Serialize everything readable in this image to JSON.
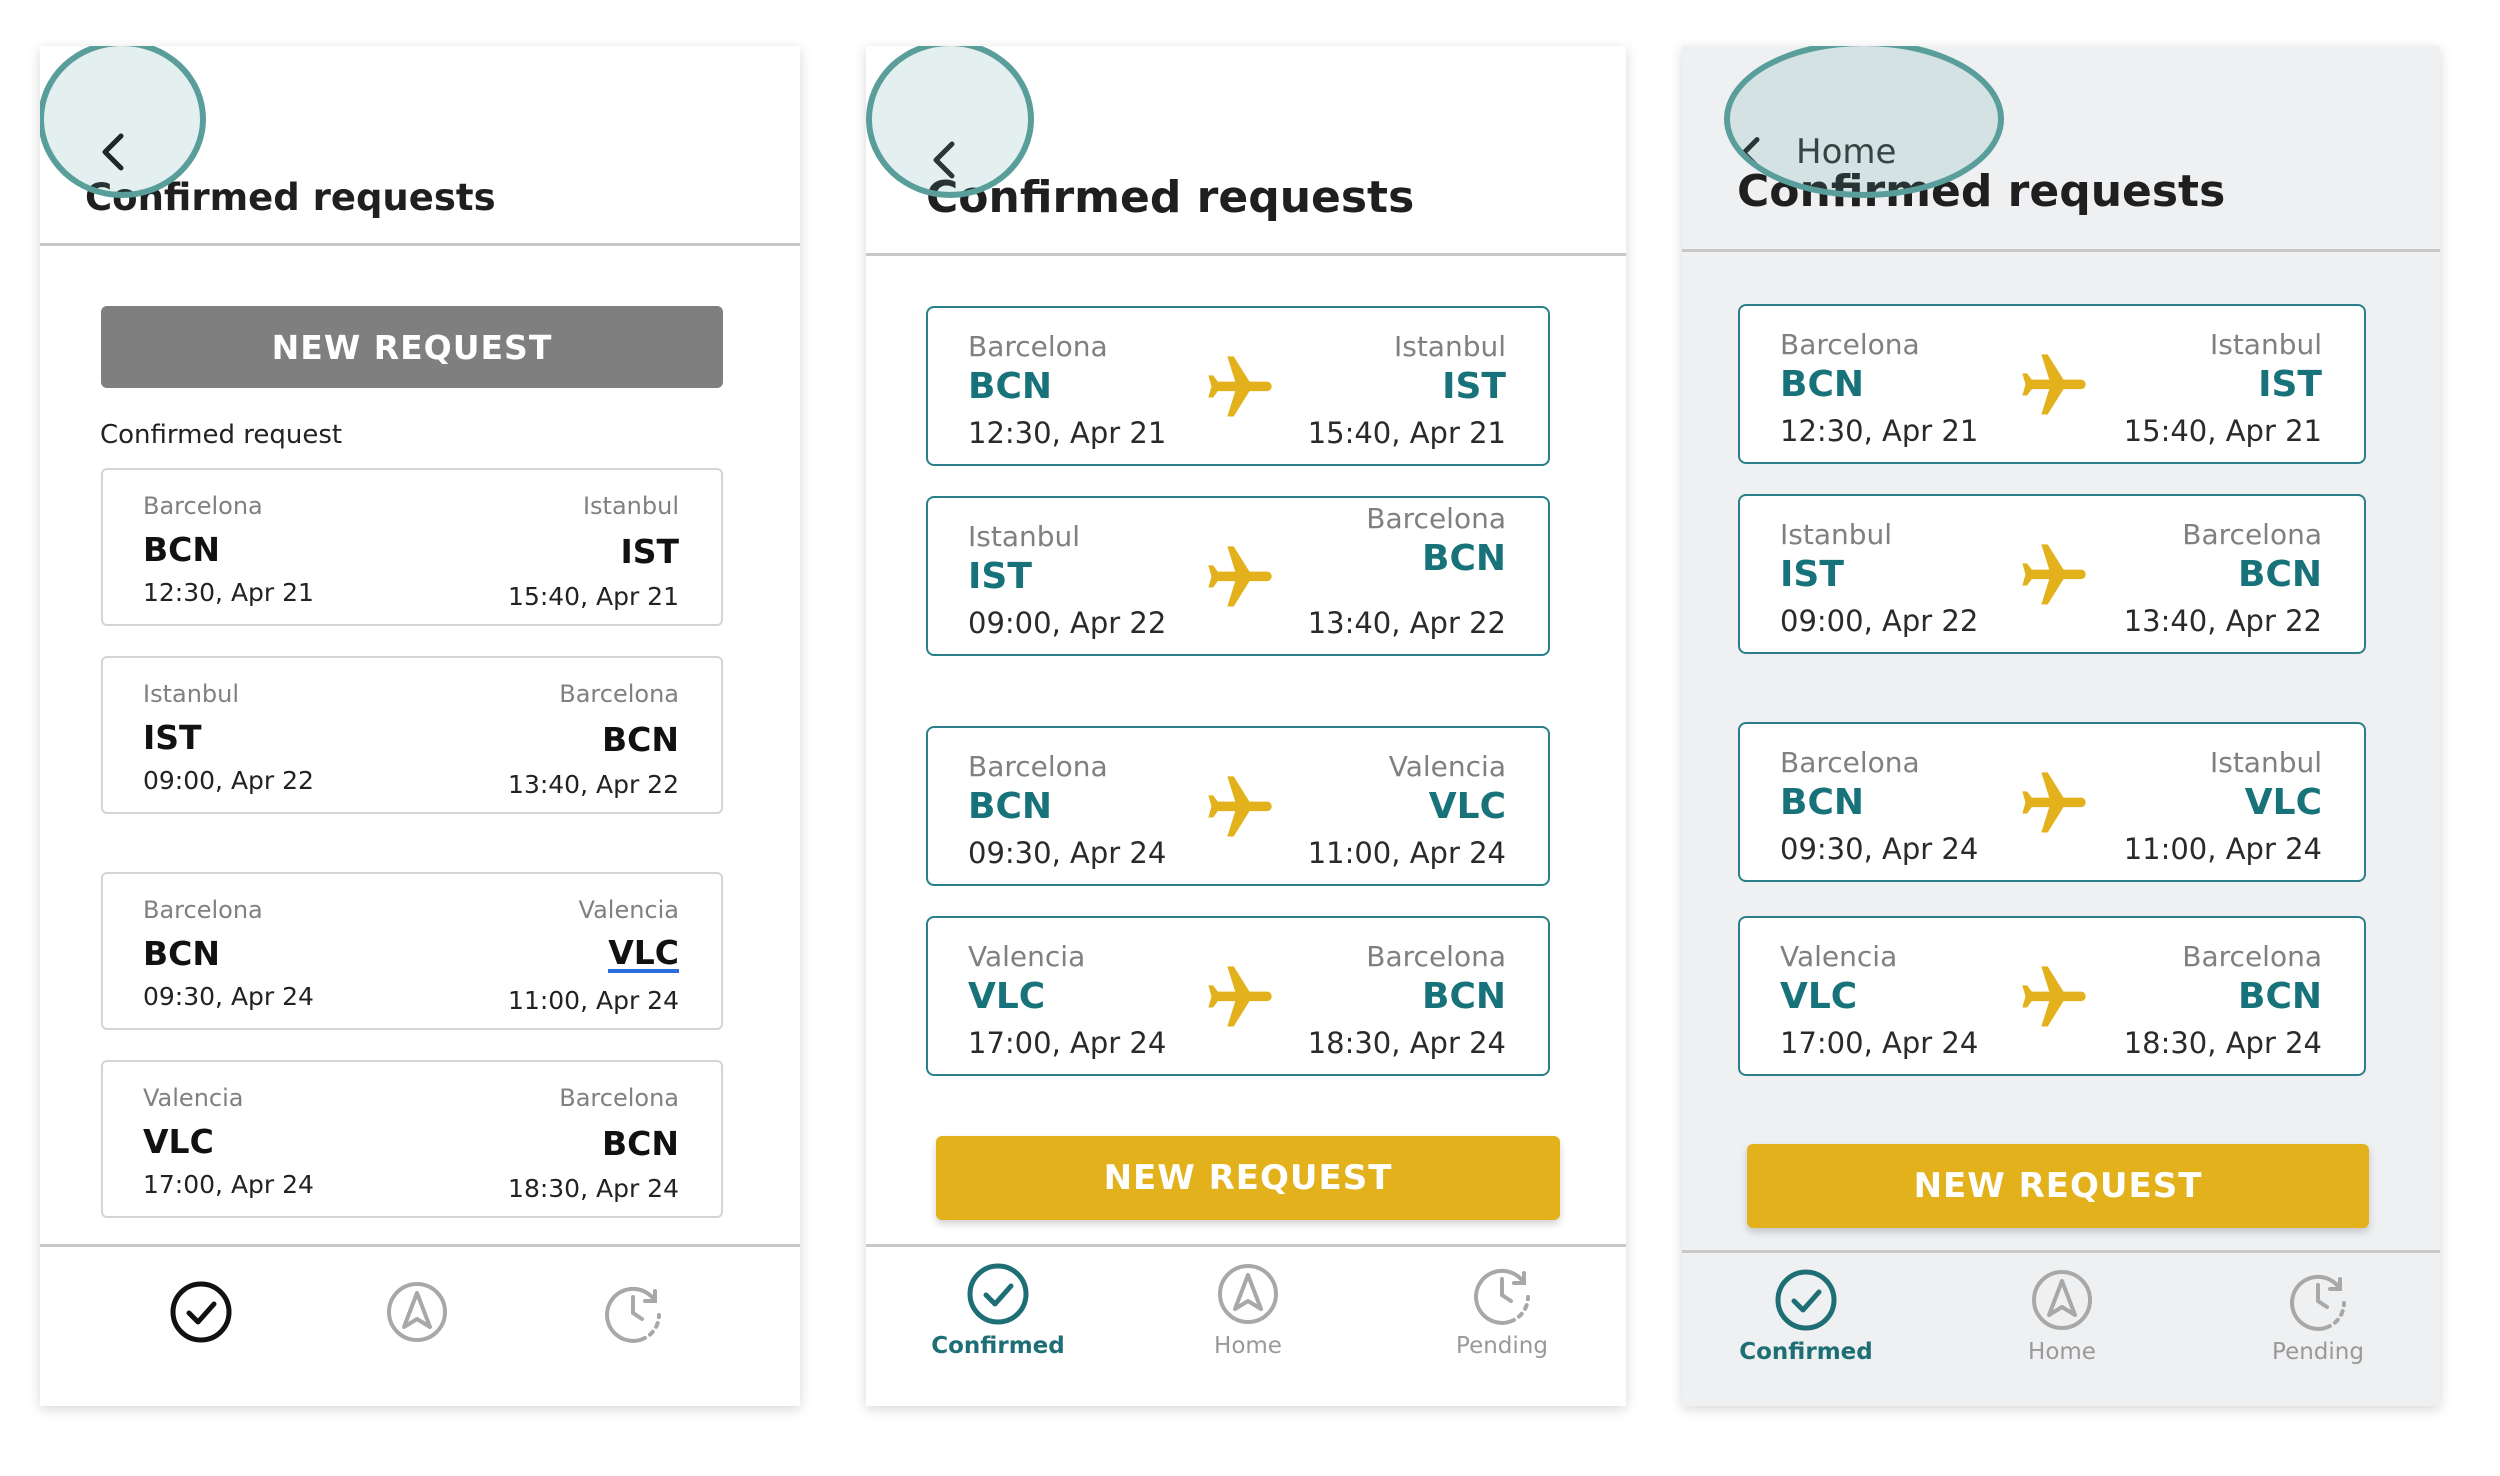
{
  "screens": [
    {
      "title": "Confirmed requests",
      "new_request_label": "NEW REQUEST",
      "section_label": "Confirmed request",
      "flights": [
        {
          "from_city": "Barcelona",
          "from_code": "BCN",
          "depart": "12:30, Apr 21",
          "to_city": "Istanbul",
          "to_code": "IST",
          "arrive": "15:40, Apr 21"
        },
        {
          "from_city": "Istanbul",
          "from_code": "IST",
          "depart": "09:00, Apr 22",
          "to_city": "Barcelona",
          "to_code": "BCN",
          "arrive": "13:40, Apr 22"
        },
        {
          "from_city": "Barcelona",
          "from_code": "BCN",
          "depart": "09:30, Apr 24",
          "to_city": "Valencia",
          "to_code": "VLC",
          "arrive": "11:00, Apr 24"
        },
        {
          "from_city": "Valencia",
          "from_code": "VLC",
          "depart": "17:00, Apr 24",
          "to_city": "Barcelona",
          "to_code": "BCN",
          "arrive": "18:30, Apr 24"
        }
      ],
      "tabs": {
        "confirmed_icon": "check-circle-icon",
        "home_icon": "compass-icon",
        "pending_icon": "clock-refresh-icon"
      }
    },
    {
      "title": "Confirmed requests",
      "new_request_label": "NEW REQUEST",
      "flights": [
        {
          "from_city": "Barcelona",
          "from_code": "BCN",
          "depart": "12:30, Apr 21",
          "to_city": "Istanbul",
          "to_code": "IST",
          "arrive": "15:40, Apr 21"
        },
        {
          "from_city": "Istanbul",
          "from_code": "IST",
          "depart": "09:00, Apr 22",
          "to_city": "Barcelona",
          "to_code": "BCN",
          "arrive": "13:40, Apr 22"
        },
        {
          "from_city": "Barcelona",
          "from_code": "BCN",
          "depart": "09:30, Apr 24",
          "to_city": "Valencia",
          "to_code": "VLC",
          "arrive": "11:00, Apr 24"
        },
        {
          "from_city": "Valencia",
          "from_code": "VLC",
          "depart": "17:00, Apr 24",
          "to_city": "Barcelona",
          "to_code": "BCN",
          "arrive": "18:30, Apr 24"
        }
      ],
      "tabs": {
        "confirmed_label": "Confirmed",
        "home_label": "Home",
        "pending_label": "Pending"
      }
    },
    {
      "back_label": "Home",
      "title": "Confirmed requests",
      "new_request_label": "NEW REQUEST",
      "flights": [
        {
          "from_city": "Barcelona",
          "from_code": "BCN",
          "depart": "12:30, Apr 21",
          "to_city": "Istanbul",
          "to_code": "IST",
          "arrive": "15:40, Apr 21"
        },
        {
          "from_city": "Istanbul",
          "from_code": "IST",
          "depart": "09:00, Apr 22",
          "to_city": "Barcelona",
          "to_code": "BCN",
          "arrive": "13:40, Apr 22"
        },
        {
          "from_city": "Barcelona",
          "from_code": "BCN",
          "depart": "09:30, Apr 24",
          "to_city": "Istanbul",
          "to_code": "VLC",
          "arrive": "11:00, Apr 24"
        },
        {
          "from_city": "Valencia",
          "from_code": "VLC",
          "depart": "17:00, Apr 24",
          "to_city": "Barcelona",
          "to_code": "BCN",
          "arrive": "18:30, Apr 24"
        }
      ],
      "tabs": {
        "confirmed_label": "Confirmed",
        "home_label": "Home",
        "pending_label": "Pending"
      }
    }
  ],
  "colors": {
    "teal": "#18727a",
    "gold": "#e2b11b",
    "grey_button": "#7f7f7f",
    "highlight": "#5a9e9b"
  }
}
